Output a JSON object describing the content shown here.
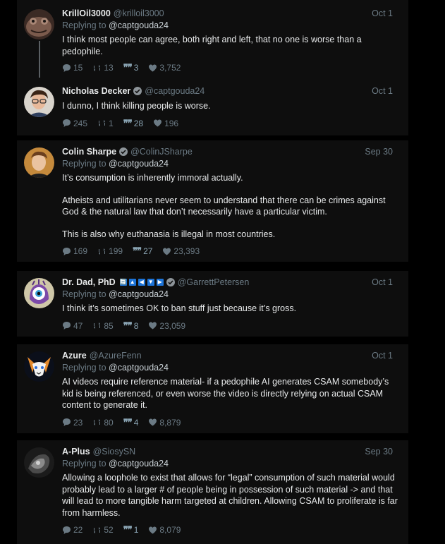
{
  "colors": {
    "background": "#000000",
    "card": "#0e0e0e",
    "muted": "#6b7a84",
    "text": "#e7e9ea",
    "badge_blue": "#1d74d8"
  },
  "posts": [
    {
      "name": "KrillOil3000",
      "handle": "@krilloil3000",
      "date": "Oct 1",
      "replying_prefix": "Replying to",
      "replying_to": "@captgouda24",
      "body": [
        "I think most people can agree, both right and left, that no one is worse than a pedophile."
      ],
      "replies": "15",
      "retweets": "13",
      "quotes": "3",
      "likes": "3,752",
      "avatar_icon": "frog-avatar"
    },
    {
      "name": "Nicholas Decker",
      "handle": "@captgouda24",
      "date": "Oct 1",
      "verified": true,
      "body": [
        "I dunno, I think killing people is worse."
      ],
      "replies": "245",
      "retweets": "1",
      "quotes": "28",
      "likes": "196",
      "avatar_icon": "person-avatar"
    },
    {
      "name": "Colin Sharpe",
      "handle": "@ColinJSharpe",
      "date": "Sep 30",
      "verified": true,
      "replying_prefix": "Replying to",
      "replying_to": "@captgouda24",
      "body": [
        "It’s consumption is inherently immoral actually.",
        "Atheists and utilitarians never seem to understand that there can be crimes against God & the natural law that don’t necessarily have a particular victim.",
        "This is also why euthanasia is illegal in most countries."
      ],
      "replies": "169",
      "retweets": "199",
      "quotes": "27",
      "likes": "23,393",
      "avatar_icon": "person-avatar"
    },
    {
      "name": "Dr. Dad, PhD",
      "handle": "@GarrettPetersen",
      "date": "Oct 1",
      "verified": true,
      "badges": [
        "🔄",
        "▲",
        "◀",
        "▼",
        "▶"
      ],
      "replying_prefix": "Replying to",
      "replying_to": "@captgouda24",
      "body": [
        "I think it’s sometimes OK to ban stuff just because it’s gross."
      ],
      "replies": "47",
      "retweets": "85",
      "quotes": "8",
      "likes": "23,059",
      "avatar_icon": "eyeball-avatar"
    },
    {
      "name": "Azure",
      "handle": "@AzureFenn",
      "date": "Oct 1",
      "replying_prefix": "Replying to",
      "replying_to": "@captgouda24",
      "body": [
        "AI videos require reference material- if a pedophile AI generates CSAM somebody’s kid is being referenced, or even worse the video is directly relying on actual CSAM content to generate it."
      ],
      "replies": "23",
      "retweets": "80",
      "quotes": "4",
      "likes": "8,879",
      "avatar_icon": "fox-avatar"
    },
    {
      "name": "A-Plus",
      "handle": "@SiosySN",
      "date": "Sep 30",
      "replying_prefix": "Replying to",
      "replying_to": "@captgouda24",
      "body": [
        "Allowing a loophole to exist that allows for “legal” consumption of such material would probably lead to a larger # of people being in possession of such material -> and that will lead to more tangible harm targeted at children. Allowing CSAM to proliferate is far from harmless."
      ],
      "replies": "22",
      "retweets": "52",
      "quotes": "1",
      "likes": "8,079",
      "avatar_icon": "abstract-avatar"
    }
  ]
}
